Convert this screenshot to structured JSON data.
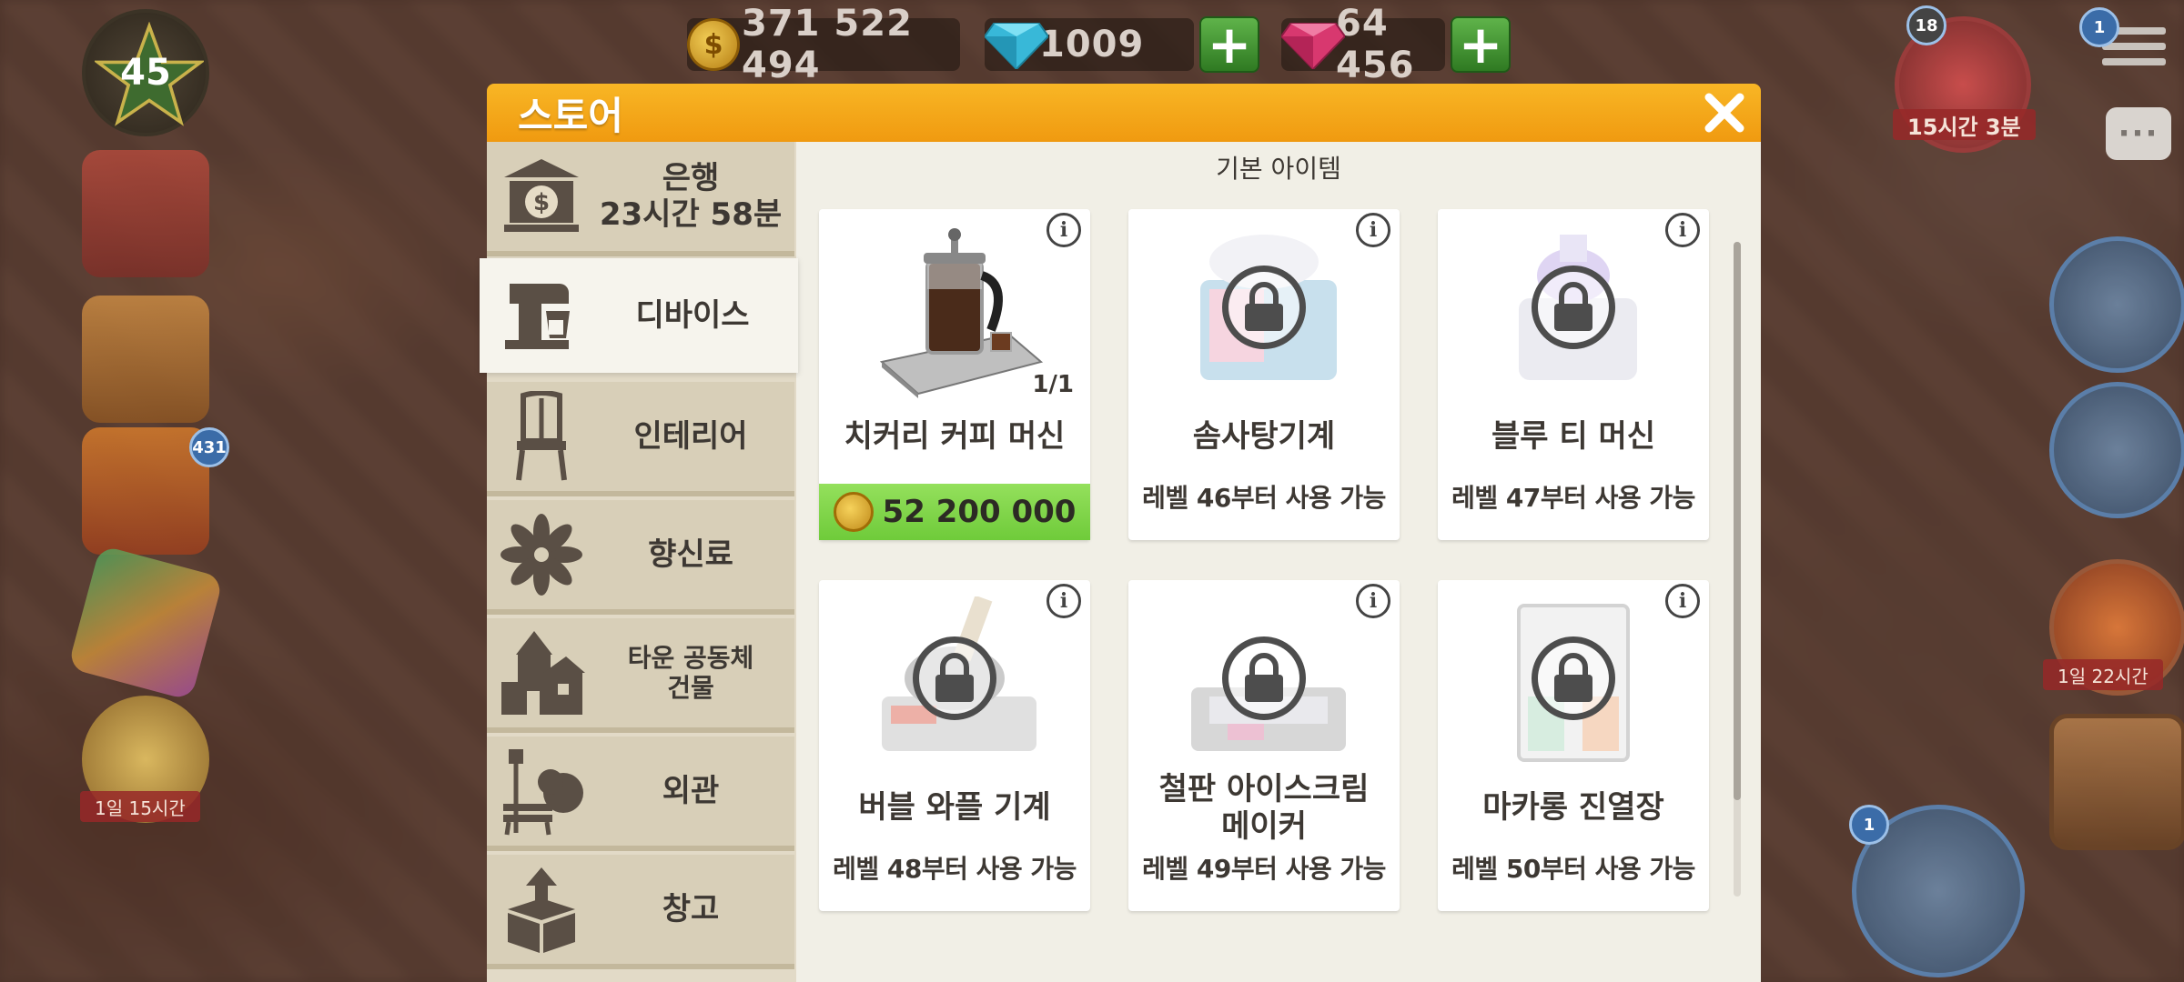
{
  "resources": {
    "coins": "371 522 494",
    "diamonds": "1009",
    "rubies": "64 456"
  },
  "hud": {
    "level": "45",
    "gift_badge": "431",
    "left_timer": "1일 15시간",
    "top_right_badge": "18",
    "top_right_timer": "15시간 3분",
    "menu_badge": "1",
    "balloon_timer": "1일 22시간",
    "register_badge": "1"
  },
  "store": {
    "title": "스토어",
    "section_title": "기본 아이템",
    "sidebar": [
      {
        "label_line1": "은행",
        "label_line2": "23시간 58분",
        "icon": "bank-icon"
      },
      {
        "label_line1": "디바이스",
        "label_line2": "",
        "icon": "mixer-icon"
      },
      {
        "label_line1": "인테리어",
        "label_line2": "",
        "icon": "chair-icon"
      },
      {
        "label_line1": "향신료",
        "label_line2": "",
        "icon": "star-anise-icon"
      },
      {
        "label_line1": "타운 공동체",
        "label_line2": "건물",
        "icon": "town-building-icon"
      },
      {
        "label_line1": "외관",
        "label_line2": "",
        "icon": "bench-icon"
      },
      {
        "label_line1": "창고",
        "label_line2": "",
        "icon": "box-icon"
      }
    ],
    "items": [
      {
        "name": "치커리 커피 머신",
        "count": "1/1",
        "price": "52 200 000",
        "locked": false
      },
      {
        "name": "솜사탕기계",
        "requirement": "레벨 46부터 사용 가능",
        "locked": true
      },
      {
        "name": "블루 티 머신",
        "requirement": "레벨 47부터 사용 가능",
        "locked": true
      },
      {
        "name": "버블 와플 기계",
        "requirement": "레벨 48부터 사용 가능",
        "locked": true
      },
      {
        "name_line1": "철판 아이스크림",
        "name_line2": "메이커",
        "requirement": "레벨 49부터 사용 가능",
        "locked": true
      },
      {
        "name": "마카롱 진열장",
        "requirement": "레벨 50부터 사용 가능",
        "locked": true
      }
    ]
  },
  "colors": {
    "header_orange": "#f5a81a",
    "price_green": "#7dd447",
    "sidebar_bg": "#d8cfb8",
    "panel_bg": "#f1efe6"
  }
}
